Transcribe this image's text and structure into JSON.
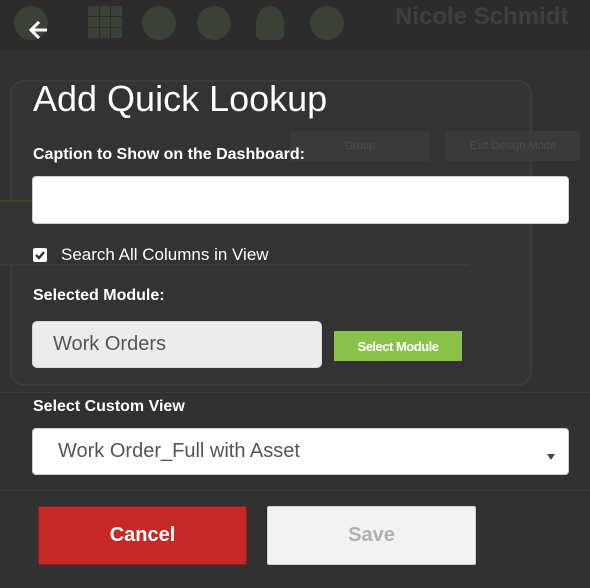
{
  "background": {
    "username": "Nicole Schmidt",
    "icons": [
      "gear-icon",
      "calendar-grid-icon",
      "location-icon",
      "tools-icon",
      "bell-icon",
      "help-icon"
    ],
    "buttons": [
      "Group",
      "Exit Design Mode"
    ]
  },
  "dialog": {
    "back_icon": "arrow-left-icon",
    "title": "Add Quick Lookup",
    "caption_label": "Caption to Show on the Dashboard:",
    "caption_value": "",
    "search_all_label": "Search All Columns in View",
    "search_all_checked": true,
    "selected_module_label": "Selected Module:",
    "selected_module_value": "Work Orders",
    "select_module_button": "Select Module",
    "custom_view_label": "Select Custom View",
    "custom_view_value": "Work Order_Full with Asset",
    "cancel_button": "Cancel",
    "save_button": "Save"
  },
  "colors": {
    "overlay": "#313131",
    "accent_green": "#8bc34a",
    "cancel_red": "#c62828",
    "save_disabled": "#f2f2f2"
  }
}
